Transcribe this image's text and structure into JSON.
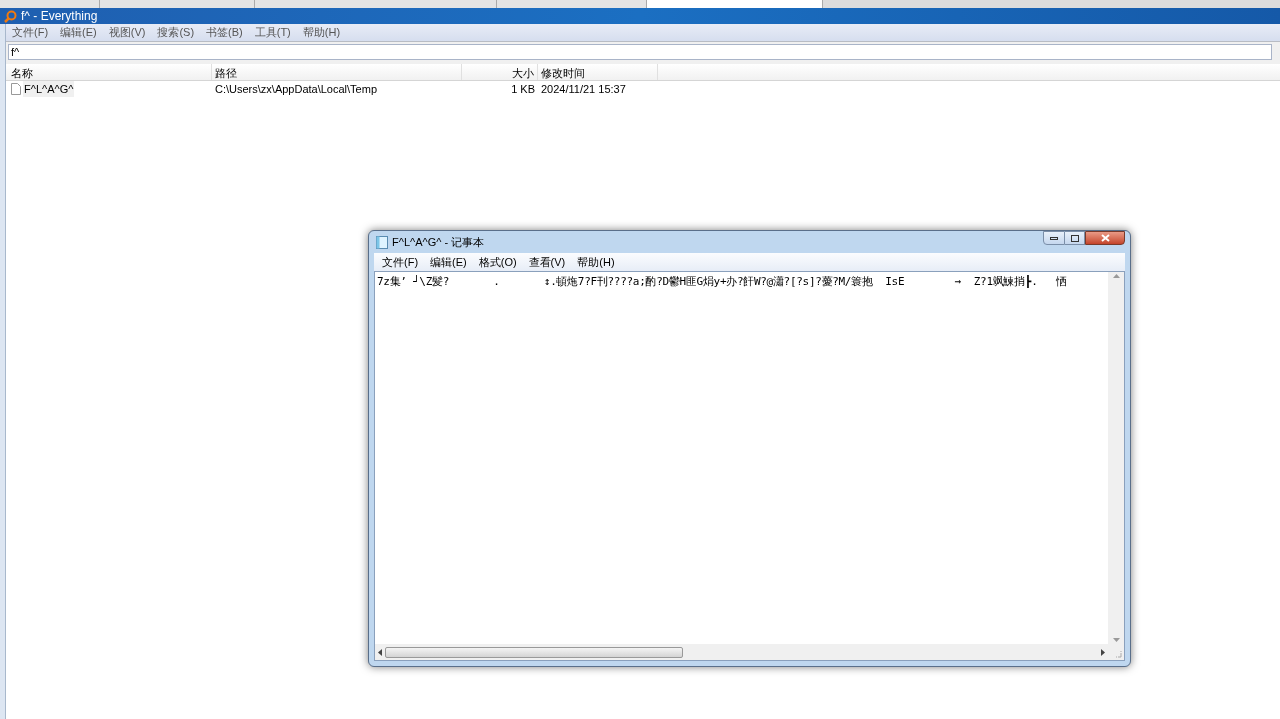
{
  "background_tabs": [
    {
      "selected": false
    },
    {
      "selected": false
    },
    {
      "selected": false
    },
    {
      "selected": false
    },
    {
      "selected": true
    }
  ],
  "main_window": {
    "title": "f^ - Everything",
    "menu": [
      "文件(F)",
      "编辑(E)",
      "视图(V)",
      "搜索(S)",
      "书签(B)",
      "工具(T)",
      "帮助(H)"
    ],
    "search": {
      "value": "f^"
    },
    "table": {
      "columns": [
        "名称",
        "路径",
        "大小",
        "修改时间"
      ],
      "rows": [
        {
          "name": "F^L^A^G^",
          "path": "C:\\Users\\zx\\AppData\\Local\\Temp",
          "size": "1 KB",
          "modified": "2024/11/21 15:37",
          "selected": false
        }
      ]
    }
  },
  "notepad": {
    "title": "F^L^A^G^ - 记事本",
    "menu": [
      "文件(F)",
      "编辑(E)",
      "格式(O)",
      "查看(V)",
      "帮助(H)"
    ],
    "content": "7z集’ ┘\\Z髪?       .       ↕.頓炧7?F刊????a;酌?D鬱H匪G焆y+办?飦W?@瀟?[?s]?薆?M/簑抱  IsE        →  Z?1飒鰊捎┣.   恓"
  }
}
